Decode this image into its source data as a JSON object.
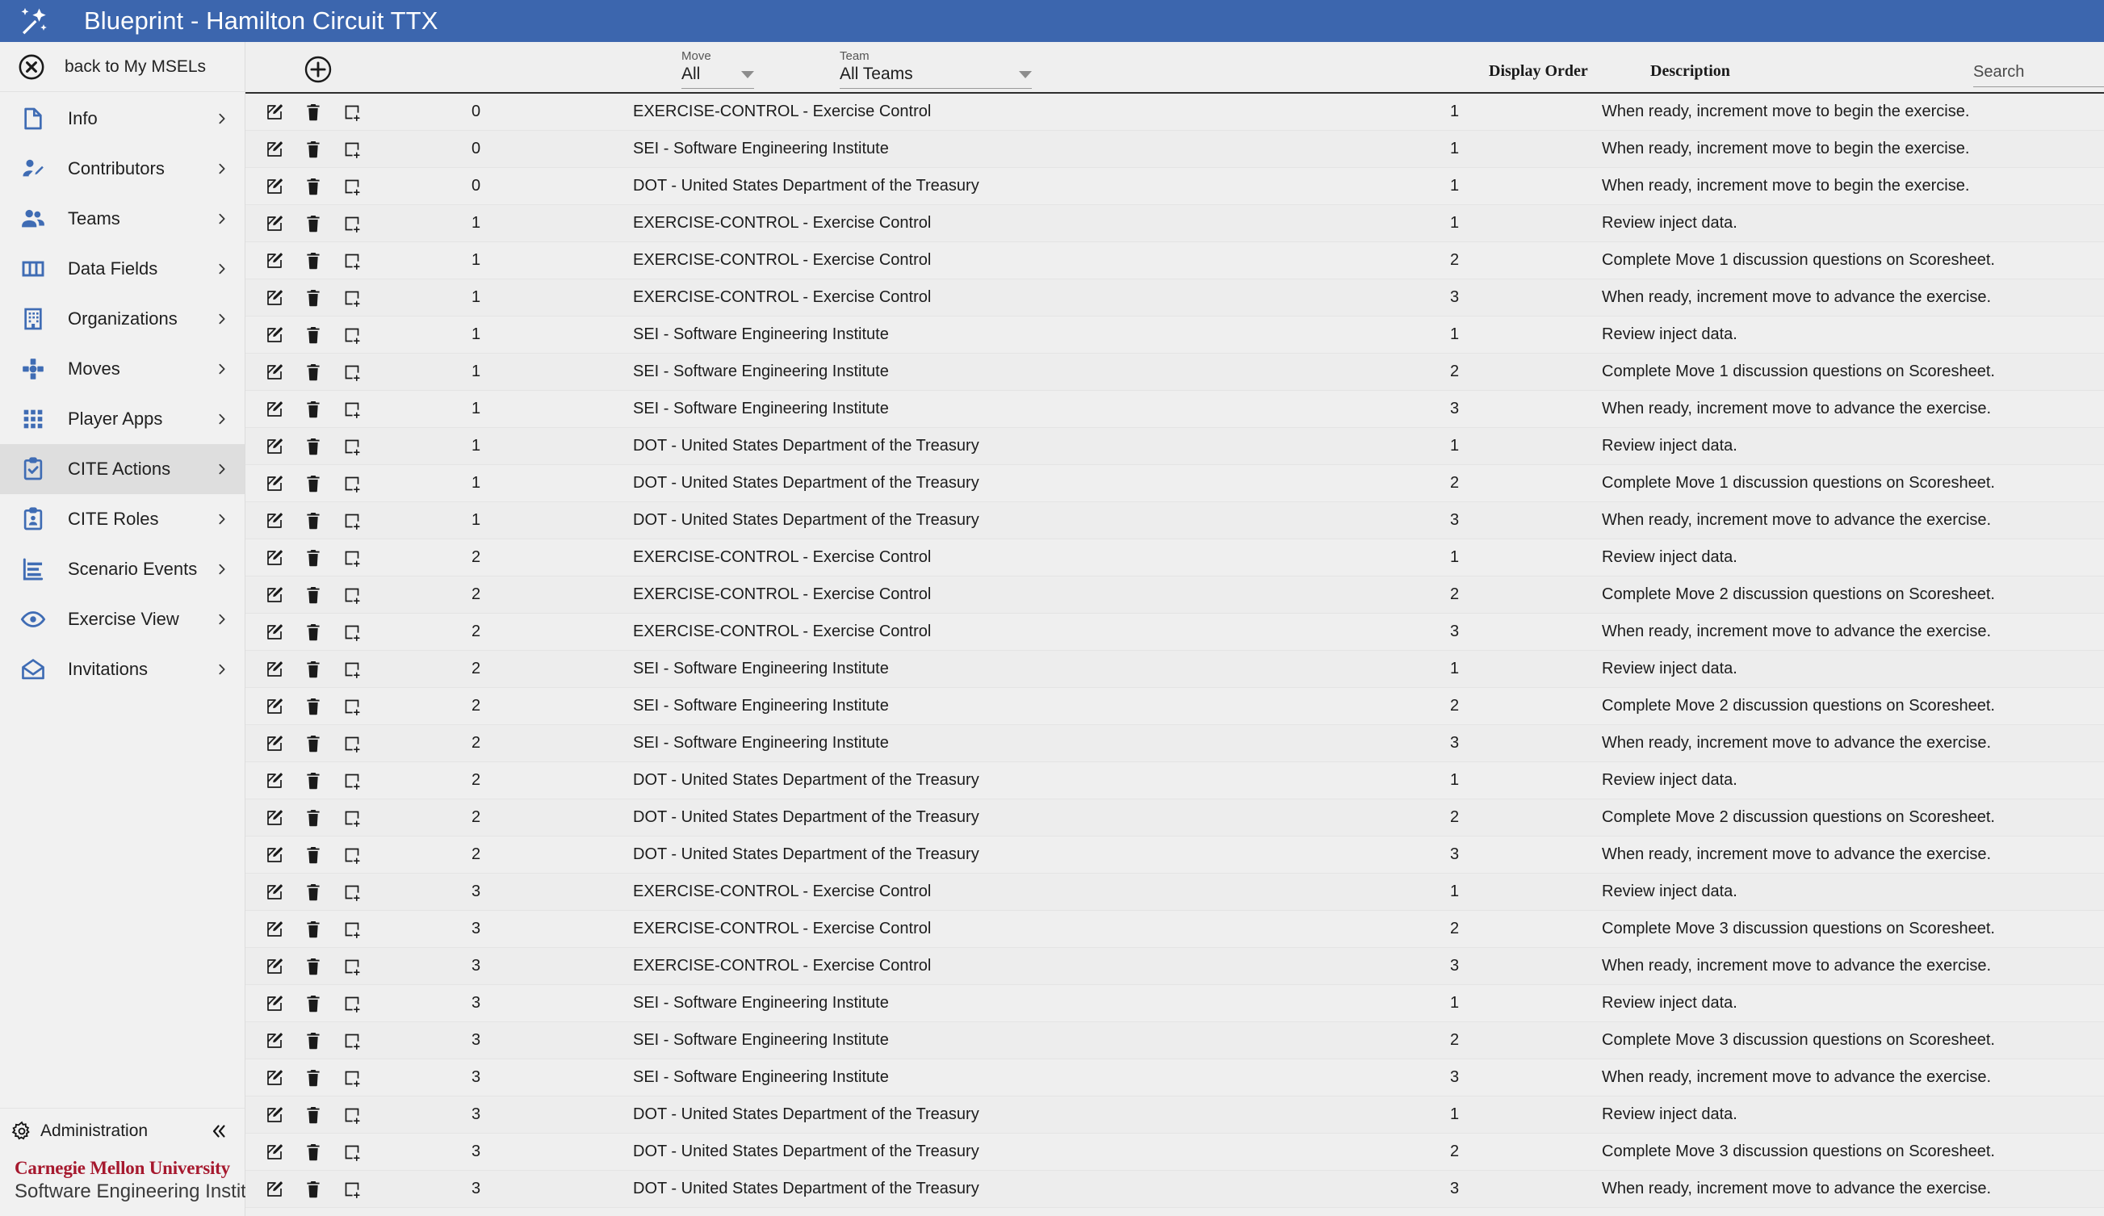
{
  "app": {
    "title": "Blueprint - Hamilton Circuit TTX",
    "logo_icon": "wand-sparkle-icon",
    "header_color": "#3c66ae"
  },
  "sidebar": {
    "back": {
      "label": "back to My MSELs",
      "icon": "close-circle-icon"
    },
    "items": [
      {
        "label": "Info",
        "icon": "document-icon",
        "active": false
      },
      {
        "label": "Contributors",
        "icon": "user-edit-icon",
        "active": false
      },
      {
        "label": "Teams",
        "icon": "people-icon",
        "active": false
      },
      {
        "label": "Data Fields",
        "icon": "columns-icon",
        "active": false
      },
      {
        "label": "Organizations",
        "icon": "building-icon",
        "active": false
      },
      {
        "label": "Moves",
        "icon": "dpad-icon",
        "active": false
      },
      {
        "label": "Player Apps",
        "icon": "grid-dots-icon",
        "active": false
      },
      {
        "label": "CITE Actions",
        "icon": "clipboard-check-icon",
        "active": true
      },
      {
        "label": "CITE Roles",
        "icon": "clipboard-user-icon",
        "active": false
      },
      {
        "label": "Scenario Events",
        "icon": "list-outline-icon",
        "active": false
      },
      {
        "label": "Exercise View",
        "icon": "eye-icon",
        "active": false
      },
      {
        "label": "Invitations",
        "icon": "envelope-open-icon",
        "active": false
      }
    ],
    "chevron_icon": "chevron-right-icon",
    "footer": {
      "admin_label": "Administration",
      "admin_icon": "gear-icon",
      "collapse_icon": "chevron-double-left-icon",
      "brand_line1": "Carnegie Mellon University",
      "brand_line2": "Software Engineering Institute",
      "brand_color": "#a6192e"
    }
  },
  "toolbar": {
    "add_icon": "plus-circle-icon",
    "move_filter": {
      "label": "Move",
      "value": "All"
    },
    "team_filter": {
      "label": "Team",
      "value": "All Teams"
    },
    "search": {
      "placeholder": "Search",
      "value": "",
      "clear_icon": "close-circle-icon"
    }
  },
  "table": {
    "columns": [
      "",
      "Move",
      "Team",
      "Display Order",
      "Description"
    ],
    "headers_visible": {
      "display_order": "Display Order",
      "description": "Description"
    },
    "row_icons": {
      "edit": "edit-square-icon",
      "delete": "trash-icon",
      "add": "add-square-icon"
    },
    "rows": [
      {
        "move": "0",
        "team": "EXERCISE-CONTROL - Exercise Control",
        "order": "1",
        "description": "When ready, increment move to begin the exercise."
      },
      {
        "move": "0",
        "team": "SEI - Software Engineering Institute",
        "order": "1",
        "description": "When ready, increment move to begin the exercise."
      },
      {
        "move": "0",
        "team": "DOT - United States Department of the Treasury",
        "order": "1",
        "description": "When ready, increment move to begin the exercise."
      },
      {
        "move": "1",
        "team": "EXERCISE-CONTROL - Exercise Control",
        "order": "1",
        "description": "Review inject data."
      },
      {
        "move": "1",
        "team": "EXERCISE-CONTROL - Exercise Control",
        "order": "2",
        "description": "Complete Move 1 discussion questions on Scoresheet."
      },
      {
        "move": "1",
        "team": "EXERCISE-CONTROL - Exercise Control",
        "order": "3",
        "description": "When ready, increment move to advance the exercise."
      },
      {
        "move": "1",
        "team": "SEI - Software Engineering Institute",
        "order": "1",
        "description": "Review inject data."
      },
      {
        "move": "1",
        "team": "SEI - Software Engineering Institute",
        "order": "2",
        "description": "Complete Move 1 discussion questions on Scoresheet."
      },
      {
        "move": "1",
        "team": "SEI - Software Engineering Institute",
        "order": "3",
        "description": "When ready, increment move to advance the exercise."
      },
      {
        "move": "1",
        "team": "DOT - United States Department of the Treasury",
        "order": "1",
        "description": "Review inject data."
      },
      {
        "move": "1",
        "team": "DOT - United States Department of the Treasury",
        "order": "2",
        "description": "Complete Move 1 discussion questions on Scoresheet."
      },
      {
        "move": "1",
        "team": "DOT - United States Department of the Treasury",
        "order": "3",
        "description": "When ready, increment move to advance the exercise."
      },
      {
        "move": "2",
        "team": "EXERCISE-CONTROL - Exercise Control",
        "order": "1",
        "description": "Review inject data."
      },
      {
        "move": "2",
        "team": "EXERCISE-CONTROL - Exercise Control",
        "order": "2",
        "description": "Complete Move 2 discussion questions on Scoresheet."
      },
      {
        "move": "2",
        "team": "EXERCISE-CONTROL - Exercise Control",
        "order": "3",
        "description": "When ready, increment move to advance the exercise."
      },
      {
        "move": "2",
        "team": "SEI - Software Engineering Institute",
        "order": "1",
        "description": "Review inject data."
      },
      {
        "move": "2",
        "team": "SEI - Software Engineering Institute",
        "order": "2",
        "description": "Complete Move 2 discussion questions on Scoresheet."
      },
      {
        "move": "2",
        "team": "SEI - Software Engineering Institute",
        "order": "3",
        "description": "When ready, increment move to advance the exercise."
      },
      {
        "move": "2",
        "team": "DOT - United States Department of the Treasury",
        "order": "1",
        "description": "Review inject data."
      },
      {
        "move": "2",
        "team": "DOT - United States Department of the Treasury",
        "order": "2",
        "description": "Complete Move 2 discussion questions on Scoresheet."
      },
      {
        "move": "2",
        "team": "DOT - United States Department of the Treasury",
        "order": "3",
        "description": "When ready, increment move to advance the exercise."
      },
      {
        "move": "3",
        "team": "EXERCISE-CONTROL - Exercise Control",
        "order": "1",
        "description": "Review inject data."
      },
      {
        "move": "3",
        "team": "EXERCISE-CONTROL - Exercise Control",
        "order": "2",
        "description": "Complete Move 3 discussion questions on Scoresheet."
      },
      {
        "move": "3",
        "team": "EXERCISE-CONTROL - Exercise Control",
        "order": "3",
        "description": "When ready, increment move to advance the exercise."
      },
      {
        "move": "3",
        "team": "SEI - Software Engineering Institute",
        "order": "1",
        "description": "Review inject data."
      },
      {
        "move": "3",
        "team": "SEI - Software Engineering Institute",
        "order": "2",
        "description": "Complete Move 3 discussion questions on Scoresheet."
      },
      {
        "move": "3",
        "team": "SEI - Software Engineering Institute",
        "order": "3",
        "description": "When ready, increment move to advance the exercise."
      },
      {
        "move": "3",
        "team": "DOT - United States Department of the Treasury",
        "order": "1",
        "description": "Review inject data."
      },
      {
        "move": "3",
        "team": "DOT - United States Department of the Treasury",
        "order": "2",
        "description": "Complete Move 3 discussion questions on Scoresheet."
      },
      {
        "move": "3",
        "team": "DOT - United States Department of the Treasury",
        "order": "3",
        "description": "When ready, increment move to advance the exercise."
      }
    ]
  }
}
